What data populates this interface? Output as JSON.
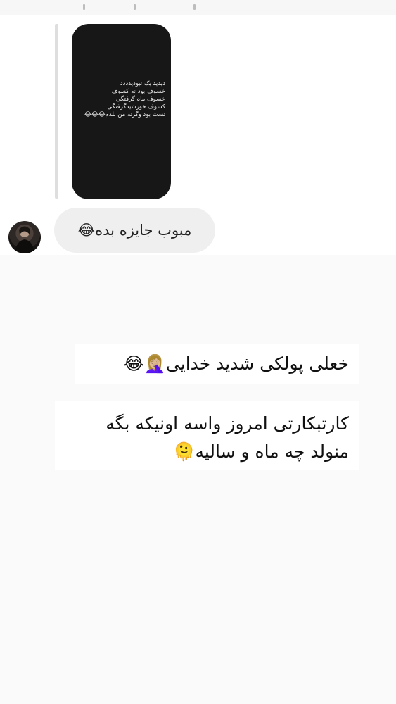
{
  "story": {
    "lines": [
      "دیدید یک نبودیدددد",
      "خسوف بود نه کسوف",
      "خسوف ماه گرفتگی",
      "کسوف خورشیدگرفتگی",
      "تست بود وگرنه من بلدم😂😂😂"
    ]
  },
  "message": {
    "text": "مبوب جایزه بده😂"
  },
  "captions": {
    "line1": "خعلی پولکی شدید خدایی🤦🏼‍♀️😂",
    "line2a": "کارتبکارتی امروز واسه اونیکه بگه",
    "line2b": "منولد چه ماه و سالیه🫠"
  }
}
